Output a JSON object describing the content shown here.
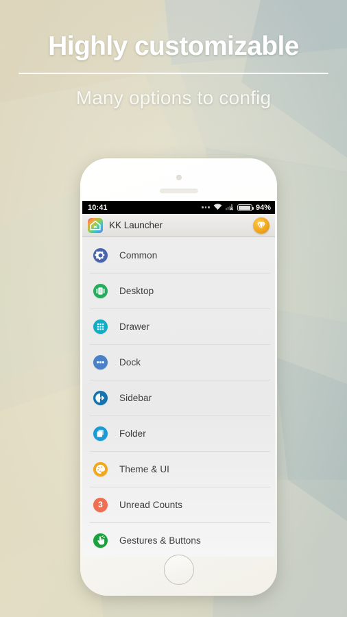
{
  "promo": {
    "title": "Highly customizable",
    "subtitle": "Many options to config"
  },
  "phone": {
    "statusbar": {
      "time": "10:41",
      "battery_percent": "94%",
      "icons": [
        "more-dots-icon",
        "wifi-icon",
        "signal-no-service-icon",
        "battery-icon"
      ]
    },
    "actionbar": {
      "app_icon": "kk-launcher-home-icon",
      "title": "KK Launcher",
      "premium_icon": "gem-icon"
    },
    "settings_list": [
      {
        "label": "Common",
        "icon": "gear-icon",
        "color": "#4a63ad"
      },
      {
        "label": "Desktop",
        "icon": "desktop-icon",
        "color": "#27ab5e"
      },
      {
        "label": "Drawer",
        "icon": "app-grid-icon",
        "color": "#12acc4"
      },
      {
        "label": "Dock",
        "icon": "dock-dots-icon",
        "color": "#4c80c4"
      },
      {
        "label": "Sidebar",
        "icon": "sidebar-arrow-icon",
        "color": "#1673ab"
      },
      {
        "label": "Folder",
        "icon": "folder-icon",
        "color": "#1b9ad6"
      },
      {
        "label": "Theme & UI",
        "icon": "palette-icon",
        "color": "#f0a81f"
      },
      {
        "label": "Unread Counts",
        "icon": "badge-count-icon",
        "color": "#ef6f52",
        "badge": "3"
      },
      {
        "label": "Gestures & Buttons",
        "icon": "hand-gesture-icon",
        "color": "#1ba03c"
      }
    ]
  },
  "colors": {
    "background_beige": "#ded7c0",
    "background_sage": "#cdd4c6",
    "background_blue_grey": "#aebcc0",
    "screen_bg": "#ededed",
    "accent_gold": "#f0a81f"
  }
}
